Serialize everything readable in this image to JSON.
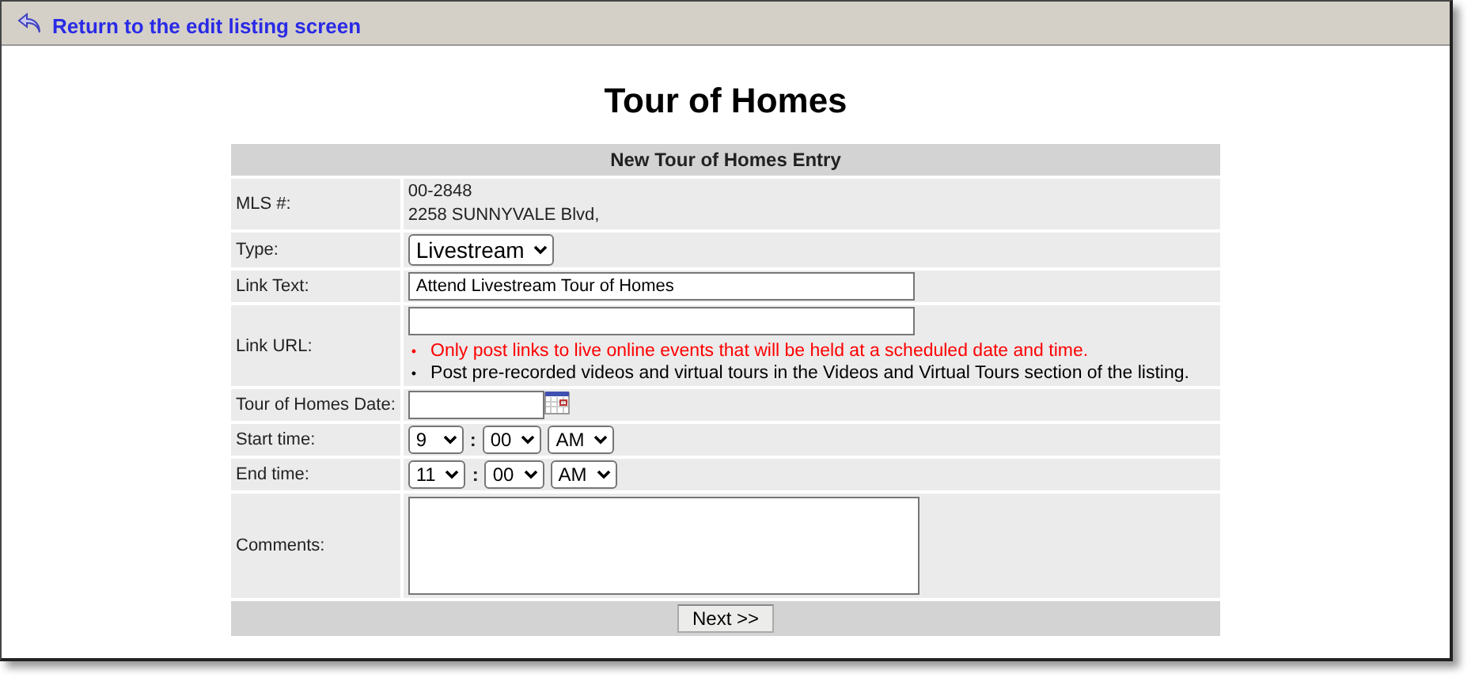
{
  "back_link": {
    "label": "Return to the edit listing screen"
  },
  "title": "Tour of Homes",
  "form": {
    "heading": "New Tour of Homes Entry",
    "rows": [
      {
        "kind": "info",
        "label": "MLS #:",
        "lines": [
          "00-2848",
          "2258 SUNNYVALE Blvd,"
        ]
      },
      {
        "kind": "select",
        "label": "Type:",
        "value": "Livestream"
      },
      {
        "kind": "text",
        "label": "Link Text:",
        "value": "Attend Livestream Tour of Homes"
      },
      {
        "kind": "text",
        "label": "Link URL:",
        "notes": [
          {
            "marker": "•",
            "text": "Only post links to live online events that will be held at a scheduled date and time.",
            "color": "#ff0000"
          },
          {
            "marker": "•",
            "text": "Post pre-recorded videos and virtual tours in the Videos and Virtual Tours section of the listing.",
            "color": "#000000"
          }
        ]
      },
      {
        "kind": "date",
        "label": "Tour of Homes Date:"
      },
      {
        "kind": "time",
        "label": "Start time:",
        "hour": "9",
        "separator": ":",
        "minute": "00",
        "period": "AM"
      },
      {
        "kind": "time",
        "label": "End time:",
        "hour": "11",
        "separator": ":",
        "minute": "00",
        "period": "AM"
      },
      {
        "kind": "textarea",
        "label": "Comments:"
      }
    ],
    "submit": "Next >>"
  }
}
